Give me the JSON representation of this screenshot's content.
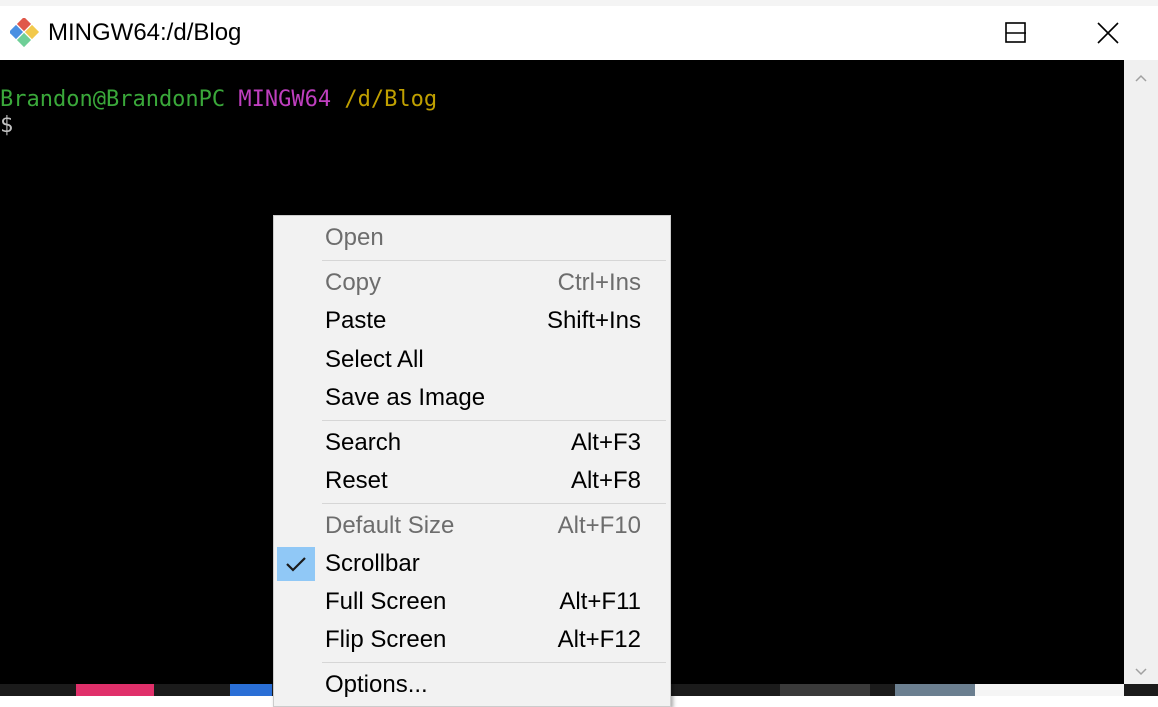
{
  "window": {
    "title": "MINGW64:/d/Blog",
    "controls": {
      "minimize": "minimize",
      "maximize": "maximize",
      "close": "close"
    }
  },
  "terminal": {
    "prompt_user": "Brandon@BrandonPC",
    "prompt_system": "MINGW64",
    "prompt_path": "/d/Blog",
    "cursor_prompt": "$",
    "colors": {
      "user": "#3aa83a",
      "system": "#bf3fbf",
      "path": "#c0a000",
      "background": "#000000"
    }
  },
  "context_menu": {
    "items": [
      {
        "label": "Open",
        "shortcut": "",
        "disabled": true
      },
      {
        "label": "Copy",
        "shortcut": "Ctrl+Ins",
        "disabled": true
      },
      {
        "label": "Paste",
        "shortcut": "Shift+Ins",
        "disabled": false
      },
      {
        "label": "Select All",
        "shortcut": "",
        "disabled": false
      },
      {
        "label": "Save as Image",
        "shortcut": "",
        "disabled": false
      },
      {
        "label": "Search",
        "shortcut": "Alt+F3",
        "disabled": false
      },
      {
        "label": "Reset",
        "shortcut": "Alt+F8",
        "disabled": false
      },
      {
        "label": "Default Size",
        "shortcut": "Alt+F10",
        "disabled": true
      },
      {
        "label": "Scrollbar",
        "shortcut": "",
        "disabled": false,
        "checked": true
      },
      {
        "label": "Full Screen",
        "shortcut": "Alt+F11",
        "disabled": false
      },
      {
        "label": "Flip Screen",
        "shortcut": "Alt+F12",
        "disabled": false
      },
      {
        "label": "Options...",
        "shortcut": "",
        "disabled": false
      }
    ],
    "check_highlight_color": "#90c8f6"
  }
}
